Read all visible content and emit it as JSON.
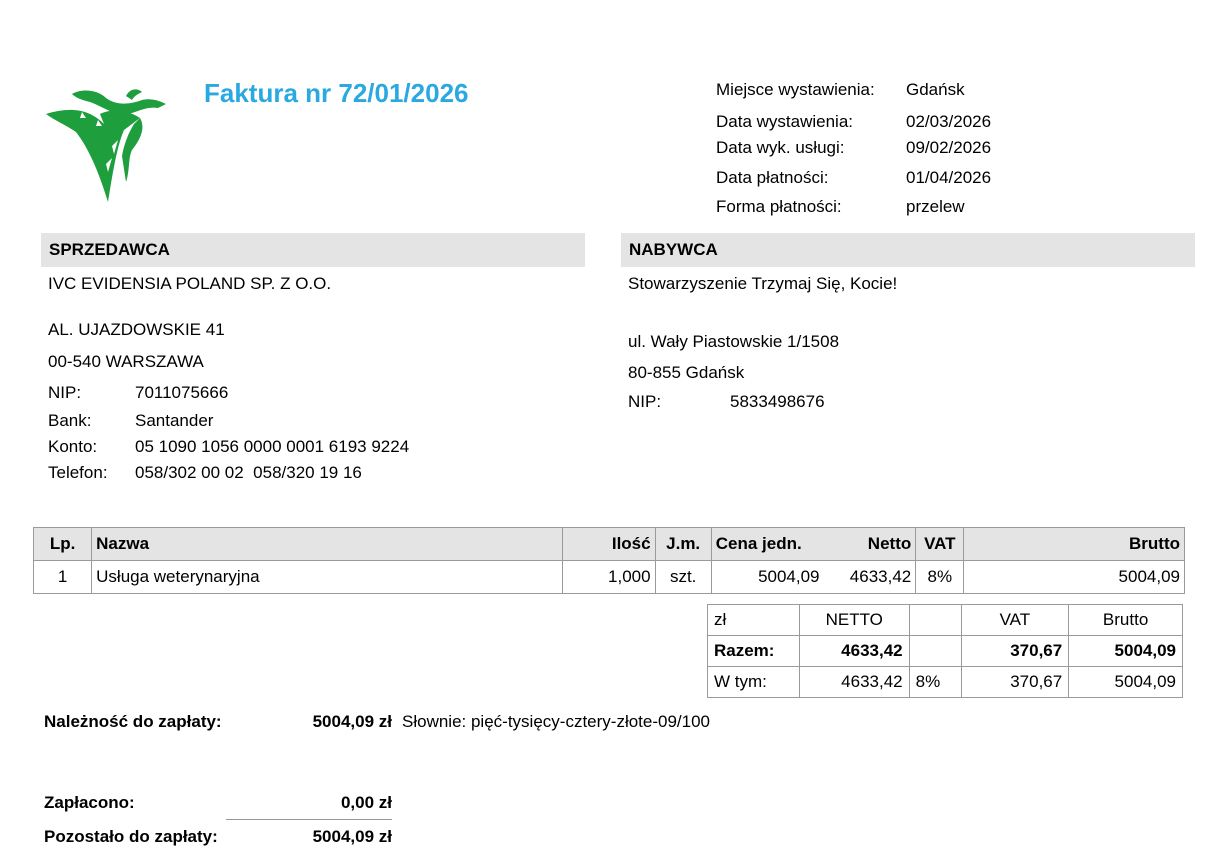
{
  "header": {
    "title": "Faktura nr 72/01/2026",
    "logo_icon": "veterinary-green-logo",
    "meta": [
      {
        "label": "Miejsce wystawienia:",
        "value": "Gdańsk"
      },
      {
        "label": "Data wystawienia:",
        "value": "02/03/2026"
      },
      {
        "label": "Data wyk. usługi:",
        "value": "09/02/2026"
      },
      {
        "label": "Data płatności:",
        "value": "01/04/2026"
      },
      {
        "label": "Forma płatności:",
        "value": "przelew"
      }
    ]
  },
  "seller": {
    "heading": "SPRZEDAWCA",
    "name": "IVC EVIDENSIA POLAND SP. Z O.O.",
    "street": "AL. UJAZDOWSKIE 41",
    "city": "00-540 WARSZAWA",
    "fields": [
      {
        "label": "NIP:",
        "value": "7011075666"
      },
      {
        "label": "Bank:",
        "value": "Santander"
      },
      {
        "label": "Konto:",
        "value": "05 1090 1056 0000 0001 6193 9224"
      },
      {
        "label": "Telefon:",
        "value": "058/302 00 02  058/320 19 16"
      }
    ]
  },
  "buyer": {
    "heading": "NABYWCA",
    "name": "Stowarzyszenie Trzymaj Się, Kocie!",
    "street": "ul. Wały Piastowskie 1/1508",
    "city": "80-855 Gdańsk",
    "nip_label": "NIP:",
    "nip_value": "5833498676"
  },
  "items_table": {
    "columns": [
      "Lp.",
      "Nazwa",
      "Ilość",
      "J.m.",
      "Cena jedn.",
      "Netto",
      "VAT",
      "Brutto"
    ],
    "rows": [
      [
        "1",
        "Usługa weterynaryjna",
        "1,000",
        "szt.",
        "5004,09",
        "4633,42",
        "8%",
        "5004,09"
      ]
    ]
  },
  "summary_table": {
    "header": [
      "zł",
      "NETTO",
      "",
      "VAT",
      "Brutto"
    ],
    "total": [
      "Razem:",
      "4633,42",
      "",
      "370,67",
      "5004,09"
    ],
    "breakdown": [
      "W tym:",
      "4633,42",
      "8%",
      "370,67",
      "5004,09"
    ]
  },
  "footer": {
    "due_label": "Należność do zapłaty:",
    "due_value": "5004,09 zł",
    "words": "Słownie: pięć-tysięcy-cztery-złote-09/100",
    "paid_label": "Zapłacono:",
    "paid_value": "0,00 zł",
    "remaining_label": "Pozostało do zapłaty:",
    "remaining_value": "5004,09 zł"
  },
  "colors": {
    "title": "#2aa8e0",
    "logo_green": "#1e9e3c",
    "header_bg": "#e4e4e4"
  }
}
